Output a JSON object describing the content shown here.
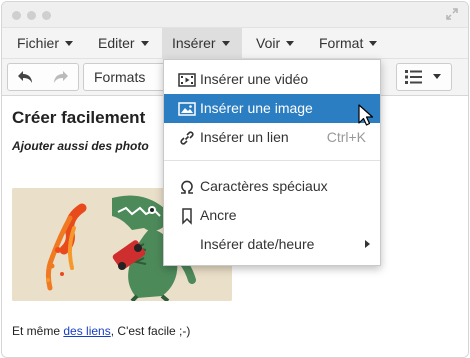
{
  "menubar": {
    "items": [
      {
        "label": "Fichier"
      },
      {
        "label": "Editer"
      },
      {
        "label": "Insérer"
      },
      {
        "label": "Voir"
      },
      {
        "label": "Format"
      }
    ]
  },
  "toolbar": {
    "formats_label": "Formats"
  },
  "content": {
    "heading": "Créer facilement",
    "subheading": "Ajouter aussi des photo",
    "paragraph_before_link": "Et même ",
    "link_text": "des liens",
    "paragraph_after_link": ", C'est facile ;-)"
  },
  "insert_menu": {
    "items": [
      {
        "label": "Insérer une vidéo",
        "icon": "video-icon"
      },
      {
        "label": "Insérer une image",
        "icon": "image-icon",
        "highlighted": true
      },
      {
        "label": "Insérer un lien",
        "icon": "link-icon",
        "shortcut": "Ctrl+K"
      },
      {
        "label": "Caractères spéciaux",
        "icon": "omega-icon"
      },
      {
        "label": "Ancre",
        "icon": "bookmark-icon"
      },
      {
        "label": "Insérer date/heure",
        "has_submenu": true
      }
    ]
  },
  "colors": {
    "highlight": "#2b7ec1",
    "link": "#1a3ec2",
    "menubar_bg": "#f4f4f4"
  }
}
